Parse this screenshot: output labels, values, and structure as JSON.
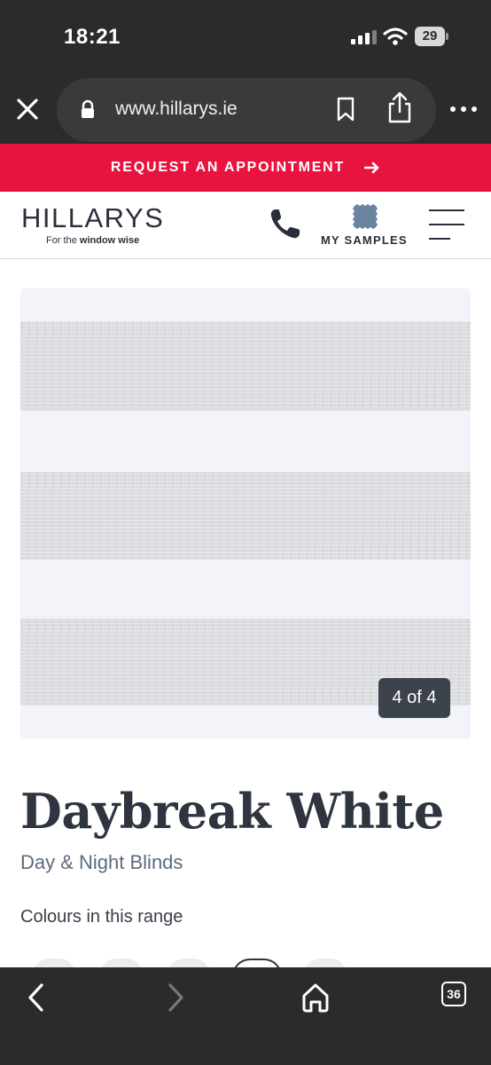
{
  "status_bar": {
    "time": "18:21",
    "battery": "29"
  },
  "browser": {
    "url": "www.hillarys.ie",
    "tab_count": "36"
  },
  "promo_banner": {
    "text": "REQUEST AN APPOINTMENT",
    "color": "#e8143f"
  },
  "header": {
    "logo": "HILLARYS",
    "tagline_prefix": "For the ",
    "tagline_bold": "window wise",
    "samples_label": "MY SAMPLES",
    "icons": [
      "phone-icon",
      "fabric-swatch-icon",
      "hamburger-menu-icon"
    ]
  },
  "gallery": {
    "counter": "4 of 4",
    "current": 4,
    "total": 4
  },
  "product": {
    "name": "Daybreak White",
    "category": "Day & Night Blinds",
    "colours_label": "Colours in this range"
  },
  "colors": {
    "chrome": "#2b2b2d",
    "text_dark": "#2e3440",
    "subtitle": "#5c6b7b"
  }
}
